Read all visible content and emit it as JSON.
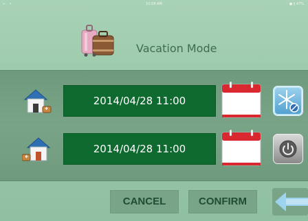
{
  "status_bar": {
    "left": "←  •",
    "time": "10:08 AM",
    "right": "● § 47%"
  },
  "header": {
    "title": "Vacation Mode",
    "icon": "luggage-icon"
  },
  "schedule": {
    "start": {
      "icon": "house-leave-icon",
      "datetime": "2014/04/28 11:00",
      "calendar_icon": "calendar-icon",
      "mode_icon": "snowflake-icon"
    },
    "end": {
      "icon": "house-return-icon",
      "datetime": "2014/04/28 11:00",
      "calendar_icon": "calendar-icon",
      "mode_icon": "power-icon"
    }
  },
  "footer": {
    "cancel_label": "CANCEL",
    "confirm_label": "CONFIRM",
    "back_icon": "back-arrow-icon"
  },
  "colors": {
    "background": "#9fcbad",
    "panel": "#79a487",
    "field": "#0e6a2e",
    "calendar_red": "#d9282f",
    "title_text": "#3f6b4f"
  }
}
